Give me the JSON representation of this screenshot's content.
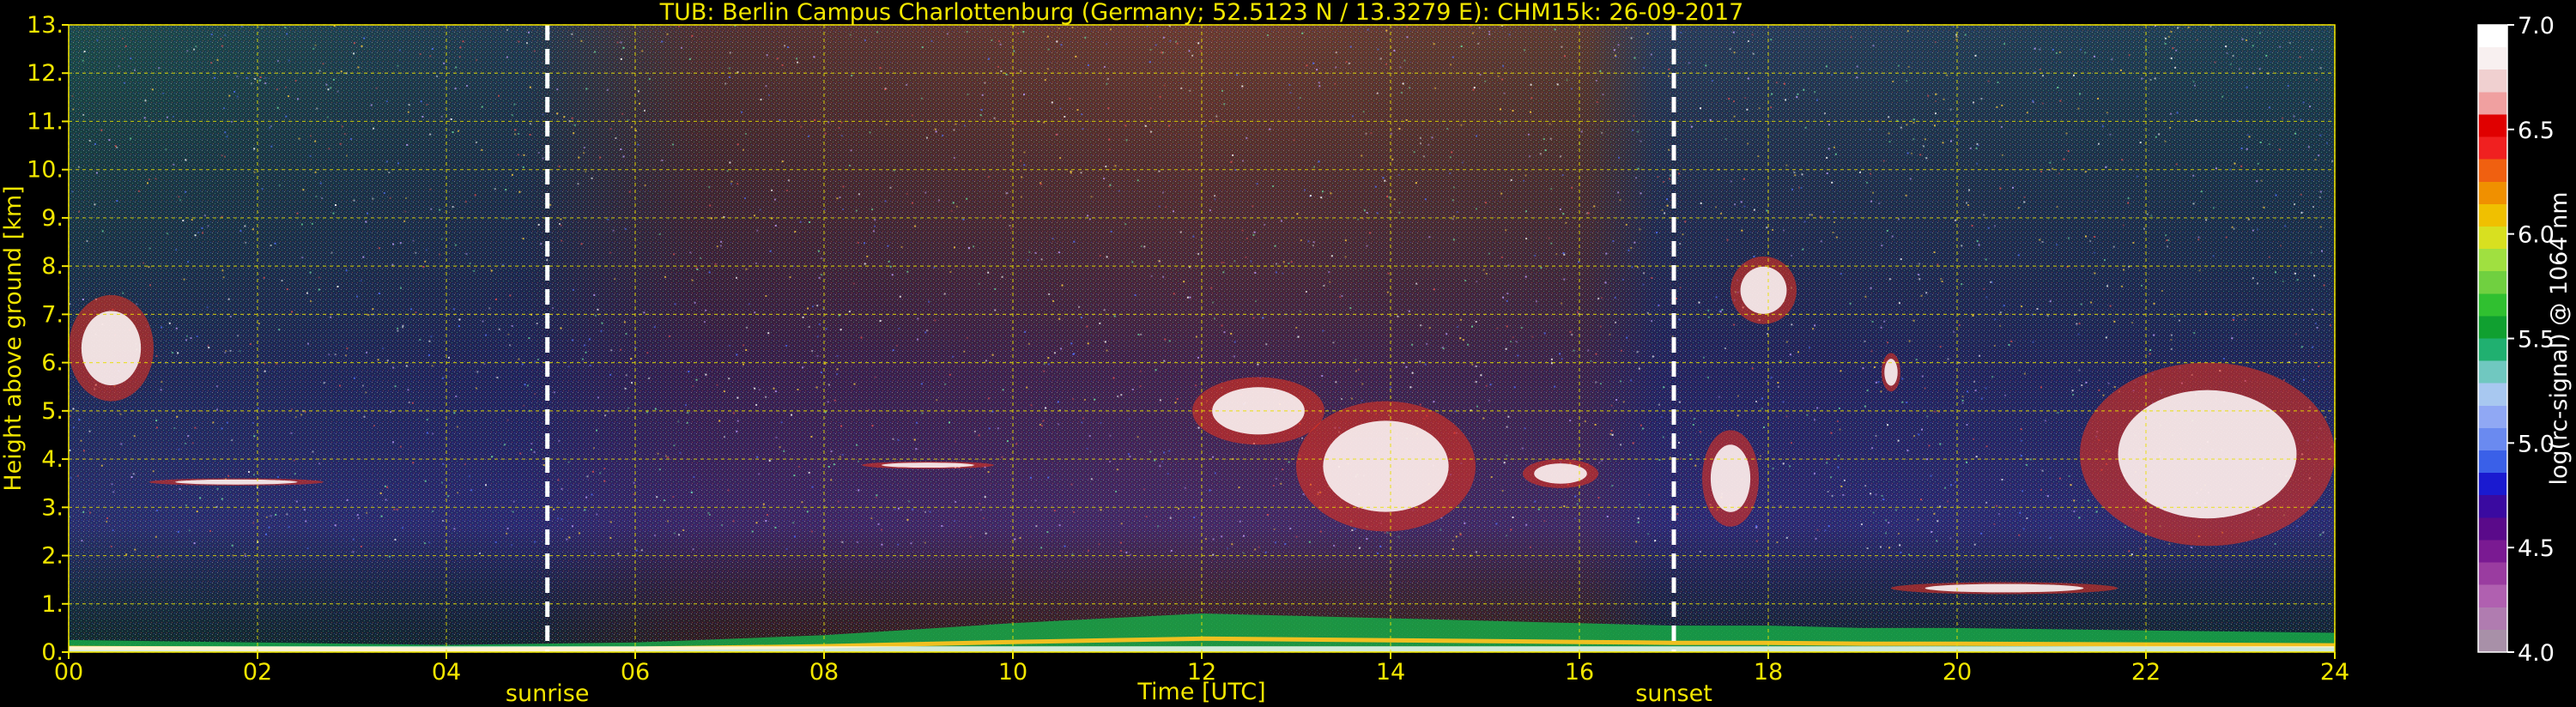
{
  "chart_data": {
    "type": "heatmap",
    "title": "TUB: Berlin Campus Charlottenburg (Germany; 52.5123 N / 13.3279 E):    CHM15k: 26-09-2017",
    "xlabel": "Time [UTC]",
    "ylabel": "Height above ground [km]",
    "xlim": [
      0,
      24
    ],
    "ylim": [
      0,
      13
    ],
    "x_ticks": [
      "00",
      "02",
      "04",
      "06",
      "08",
      "10",
      "12",
      "14",
      "16",
      "18",
      "20",
      "22",
      "24"
    ],
    "x_tick_values": [
      0,
      2,
      4,
      6,
      8,
      10,
      12,
      14,
      16,
      18,
      20,
      22,
      24
    ],
    "y_ticks": [
      "0.",
      "1.",
      "2.",
      "3.",
      "4.",
      "5.",
      "6.",
      "7.",
      "8.",
      "9.",
      "10.",
      "11.",
      "12.",
      "13."
    ],
    "y_tick_values": [
      0,
      1,
      2,
      3,
      4,
      5,
      6,
      7,
      8,
      9,
      10,
      11,
      12,
      13
    ],
    "grid": true,
    "colorbar": {
      "label": "log(rc-signal) @ 1064 nm",
      "range": [
        4.0,
        7.0
      ],
      "ticks": [
        "4.0",
        "4.5",
        "5.0",
        "5.5",
        "6.0",
        "6.5",
        "7.0"
      ],
      "tick_values": [
        4.0,
        4.5,
        5.0,
        5.5,
        6.0,
        6.5,
        7.0
      ],
      "colors": [
        "#a890a8",
        "#b07cb0",
        "#b060b0",
        "#9a3ca0",
        "#7a1a92",
        "#5a0a8a",
        "#3a0aa0",
        "#1a1ad0",
        "#3a60e8",
        "#6a8af0",
        "#90a8f4",
        "#a8c8f0",
        "#70c8c0",
        "#20b070",
        "#10a030",
        "#30c030",
        "#70d040",
        "#a0e040",
        "#d8e020",
        "#f0c000",
        "#f09000",
        "#f06010",
        "#f02020",
        "#e00000",
        "#f0a0a0",
        "#f0d0d0",
        "#f8f0f0",
        "#ffffff"
      ]
    },
    "annotations": [
      {
        "label": "sunrise",
        "x": 5.07
      },
      {
        "label": "sunset",
        "x": 17.0
      }
    ],
    "features": [
      {
        "kind": "boundary_layer_top_km",
        "x": [
          0,
          2,
          4,
          6,
          8,
          10,
          12,
          14,
          16,
          17,
          18,
          19,
          20,
          22,
          24
        ],
        "y": [
          0.25,
          0.2,
          0.15,
          0.2,
          0.35,
          0.6,
          0.8,
          0.7,
          0.6,
          0.55,
          0.55,
          0.5,
          0.5,
          0.45,
          0.4
        ]
      },
      {
        "kind": "cloud",
        "x_range": [
          0.0,
          0.9
        ],
        "y_range": [
          5.2,
          7.4
        ]
      },
      {
        "kind": "cloud",
        "x_range": [
          0.85,
          2.7
        ],
        "y_range": [
          3.45,
          3.6
        ]
      },
      {
        "kind": "cloud",
        "x_range": [
          8.4,
          9.8
        ],
        "y_range": [
          3.8,
          3.95
        ]
      },
      {
        "kind": "cloud",
        "x_range": [
          11.9,
          13.3
        ],
        "y_range": [
          4.3,
          5.7
        ]
      },
      {
        "kind": "cloud",
        "x_range": [
          13.0,
          14.9
        ],
        "y_range": [
          2.5,
          5.2
        ]
      },
      {
        "kind": "cloud",
        "x_range": [
          15.4,
          16.2
        ],
        "y_range": [
          3.4,
          4.0
        ]
      },
      {
        "kind": "cloud",
        "x_range": [
          17.3,
          17.9
        ],
        "y_range": [
          2.6,
          4.6
        ]
      },
      {
        "kind": "cloud",
        "x_range": [
          17.6,
          18.3
        ],
        "y_range": [
          6.8,
          8.2
        ]
      },
      {
        "kind": "cloud",
        "x_range": [
          19.2,
          19.4
        ],
        "y_range": [
          5.4,
          6.2
        ]
      },
      {
        "kind": "cloud",
        "x_range": [
          19.3,
          21.7
        ],
        "y_range": [
          1.2,
          1.45
        ]
      },
      {
        "kind": "cloud",
        "x_range": [
          21.3,
          24.0
        ],
        "y_range": [
          2.2,
          6.0
        ]
      }
    ]
  }
}
